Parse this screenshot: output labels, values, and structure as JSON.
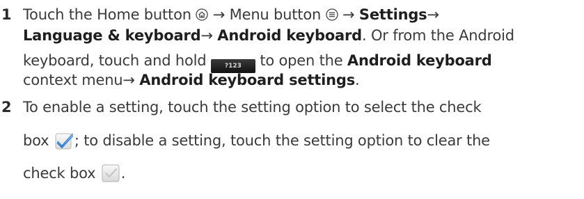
{
  "steps": [
    {
      "number": "1",
      "line1": {
        "t1": "Touch the Home button ",
        "t2": " → Menu button ",
        "t3": " → ",
        "b1": "Settings",
        "a1": "→"
      },
      "line2": {
        "b1": "Language & keyboard",
        "a1": "→ ",
        "b2": "Android keyboard",
        "t1": ". Or from the Android"
      },
      "line3": {
        "t1": "keyboard, touch and hold ",
        "key_label": "?123",
        "t2": " to open the ",
        "b1": "Android keyboard"
      },
      "line4": {
        "t1": "context menu",
        "a1": "→ ",
        "b1": "Android keyboard settings",
        "t2": "."
      }
    },
    {
      "number": "2",
      "line1": {
        "t1": "To enable a setting, touch the setting option to select the check"
      },
      "line2": {
        "t1": "box ",
        "t2": "; to disable a setting, touch the setting option to clear the"
      },
      "line3": {
        "t1": "check box ",
        "t2": "."
      }
    }
  ],
  "icons": {
    "home": "home-icon",
    "menu": "menu-icon",
    "key": "keyboard-key-icon",
    "checked": "checked-checkbox-icon",
    "unchecked": "cleared-checkbox-icon"
  },
  "colors": {
    "text": "#3a3a3a",
    "check_blue": "#3a8ee6"
  }
}
